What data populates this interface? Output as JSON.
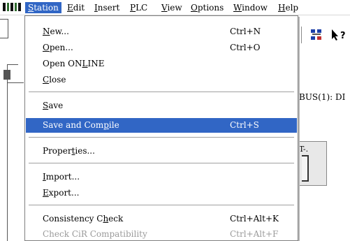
{
  "menubar": {
    "items": [
      {
        "label": "Station",
        "key": "S",
        "rest": "tation"
      },
      {
        "label": "Edit",
        "key": "E",
        "rest": "dit"
      },
      {
        "label": "Insert",
        "key": "I",
        "rest": "nsert"
      },
      {
        "label": "PLC",
        "key": "P",
        "rest": "LC"
      },
      {
        "label": "View",
        "key": "V",
        "rest": "iew"
      },
      {
        "label": "Options",
        "key": "O",
        "rest": "ptions"
      },
      {
        "label": "Window",
        "key": "W",
        "rest": "indow"
      },
      {
        "label": "Help",
        "key": "H",
        "rest": "elp"
      }
    ]
  },
  "background": {
    "bus_label": "BUS(1): DI",
    "rack_title": "T-."
  },
  "station_menu": {
    "new": {
      "pre": "",
      "key": "N",
      "post": "ew...",
      "shortcut": "Ctrl+N"
    },
    "open": {
      "pre": "",
      "key": "O",
      "post": "pen...",
      "shortcut": "Ctrl+O"
    },
    "open_online": {
      "pre": "Open ON",
      "key": "L",
      "post": "INE",
      "shortcut": ""
    },
    "close": {
      "pre": "",
      "key": "C",
      "post": "lose",
      "shortcut": ""
    },
    "save": {
      "pre": "",
      "key": "S",
      "post": "ave",
      "shortcut": ""
    },
    "save_compile": {
      "pre": "Save and Com",
      "key": "p",
      "post": "ile",
      "shortcut": "Ctrl+S"
    },
    "properties": {
      "pre": "Proper",
      "key": "t",
      "post": "ies...",
      "shortcut": ""
    },
    "import": {
      "pre": "",
      "key": "I",
      "post": "mport...",
      "shortcut": ""
    },
    "export": {
      "pre": "",
      "key": "E",
      "post": "xport...",
      "shortcut": ""
    },
    "consistency": {
      "pre": "Consistency C",
      "key": "h",
      "post": "eck",
      "shortcut": "Ctrl+Alt+K"
    },
    "cir": {
      "pre": "Check CiR Compatibility",
      "key": "",
      "post": "",
      "shortcut": "Ctrl+Alt+F"
    }
  },
  "colors": {
    "highlight": "#3166c5",
    "disabled_text": "#9a9a9a"
  }
}
